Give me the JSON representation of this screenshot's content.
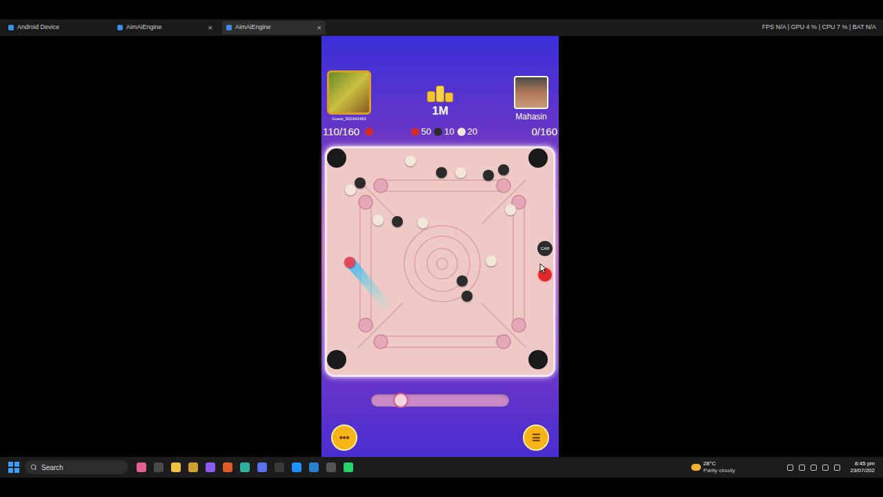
{
  "browser": {
    "tabs": [
      {
        "label": "Android Device",
        "selected": false,
        "closable": false
      },
      {
        "label": "AimAiEngine",
        "selected": false,
        "closable": true
      },
      {
        "label": "AimAiEngine",
        "selected": true,
        "closable": true
      }
    ],
    "close_glyph": "×",
    "stats": "FPS N/A | GPU 4 % | CPU 7 % | BAT N/A"
  },
  "game": {
    "players": [
      {
        "name": "Guest_931642463",
        "score": "110/160",
        "coin_color": "#d42a2a"
      },
      {
        "name": "Mahasin",
        "score": "0/160"
      }
    ],
    "pot": "1M",
    "coin_values": [
      {
        "value": "50",
        "color": "#d42a2a"
      },
      {
        "value": "10",
        "color": "#2b2b2b"
      },
      {
        "value": "20",
        "color": "#f3e7da"
      }
    ],
    "pieces": [
      {
        "color": "#f3e7da"
      },
      {
        "color": "#2b2b2b"
      },
      {
        "color": "#f3e7da"
      },
      {
        "color": "#2b2b2b"
      },
      {
        "color": "#2b2b2b"
      },
      {
        "color": "#2b2b2b"
      },
      {
        "color": "#f3e7da"
      },
      {
        "color": "#f3e7da"
      },
      {
        "color": "#f3e7da"
      },
      {
        "color": "#2b2b2b"
      },
      {
        "color": "#f3e7da"
      },
      {
        "color": "#f3e7da"
      },
      {
        "color": "#2b2b2b"
      },
      {
        "color": "#2b2b2b"
      },
      {
        "color": "#e0485a"
      }
    ],
    "overlay": {
      "label": "CAR"
    },
    "power": {
      "level": 0.16
    },
    "buttons": [
      {
        "label": "•••"
      },
      {
        "label": "☰"
      }
    ]
  },
  "taskbar": {
    "search": "Search",
    "weather": {
      "temp": "28°C",
      "condition": "Partly cloudy"
    },
    "time": "8:45 pm",
    "date": "23/07/202"
  }
}
